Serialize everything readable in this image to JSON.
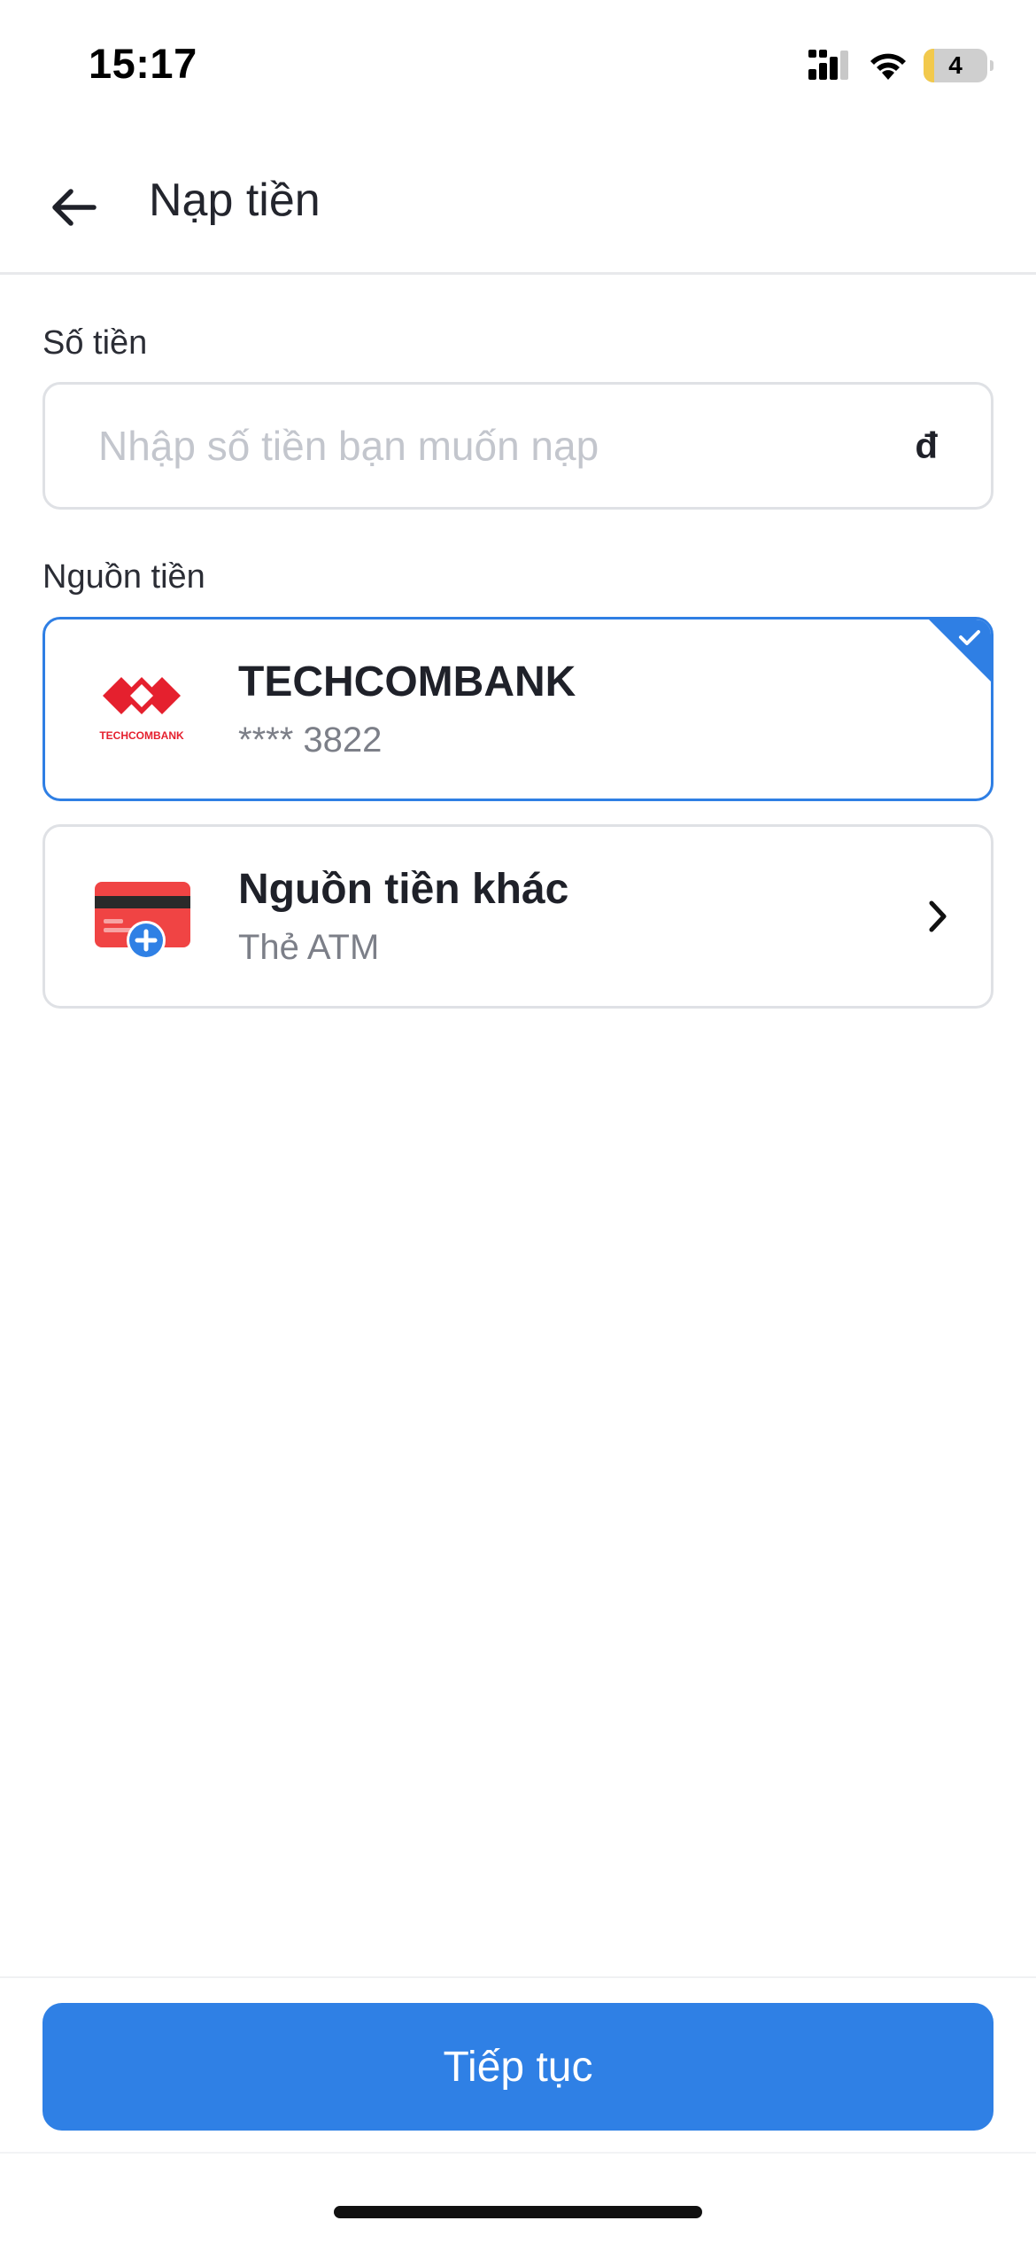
{
  "status_bar": {
    "time": "15:17",
    "battery_level": "4",
    "icons": [
      "signal-icon",
      "wifi-icon",
      "battery-icon"
    ]
  },
  "header": {
    "back_icon": "arrow-left-icon",
    "title": "Nạp tiền"
  },
  "amount": {
    "label": "Số tiền",
    "placeholder": "Nhập số tiền bạn muốn nạp",
    "value": "",
    "currency": "đ"
  },
  "sources": {
    "label": "Nguồn tiền",
    "items": [
      {
        "name": "TECHCOMBANK",
        "sub": "**** 3822",
        "logo_text": "TECHCOMBANK",
        "selected": true,
        "icon": "techcombank-logo-icon"
      },
      {
        "name": "Nguồn tiền khác",
        "sub": "Thẻ ATM",
        "selected": false,
        "icon": "add-card-icon"
      }
    ]
  },
  "footer": {
    "continue_label": "Tiếp tục"
  },
  "colors": {
    "accent": "#2F80E5",
    "selected_border": "#2F7FE4",
    "brand_red": "#E5202E",
    "card_red": "#F04444"
  }
}
